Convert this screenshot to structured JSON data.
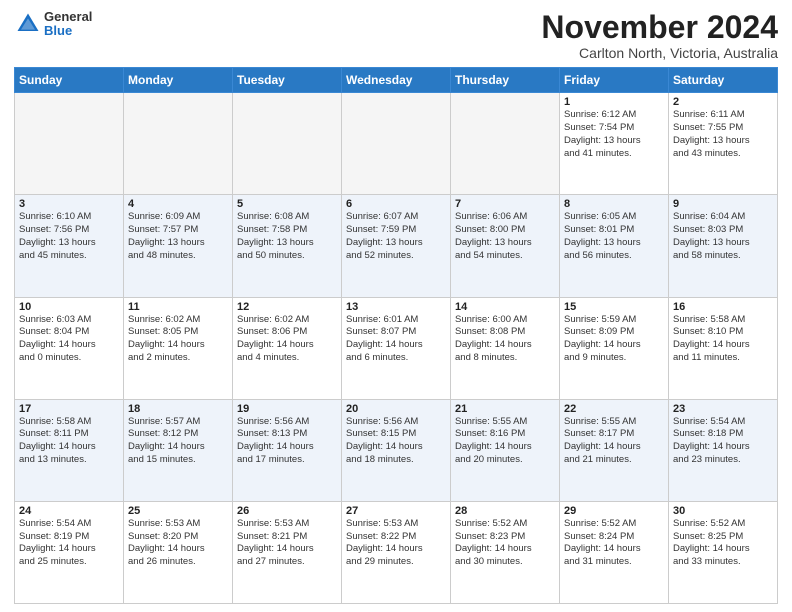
{
  "logo": {
    "general": "General",
    "blue": "Blue"
  },
  "header": {
    "month": "November 2024",
    "location": "Carlton North, Victoria, Australia"
  },
  "weekdays": [
    "Sunday",
    "Monday",
    "Tuesday",
    "Wednesday",
    "Thursday",
    "Friday",
    "Saturday"
  ],
  "weeks": [
    [
      {
        "day": "",
        "info": ""
      },
      {
        "day": "",
        "info": ""
      },
      {
        "day": "",
        "info": ""
      },
      {
        "day": "",
        "info": ""
      },
      {
        "day": "",
        "info": ""
      },
      {
        "day": "1",
        "info": "Sunrise: 6:12 AM\nSunset: 7:54 PM\nDaylight: 13 hours\nand 41 minutes."
      },
      {
        "day": "2",
        "info": "Sunrise: 6:11 AM\nSunset: 7:55 PM\nDaylight: 13 hours\nand 43 minutes."
      }
    ],
    [
      {
        "day": "3",
        "info": "Sunrise: 6:10 AM\nSunset: 7:56 PM\nDaylight: 13 hours\nand 45 minutes."
      },
      {
        "day": "4",
        "info": "Sunrise: 6:09 AM\nSunset: 7:57 PM\nDaylight: 13 hours\nand 48 minutes."
      },
      {
        "day": "5",
        "info": "Sunrise: 6:08 AM\nSunset: 7:58 PM\nDaylight: 13 hours\nand 50 minutes."
      },
      {
        "day": "6",
        "info": "Sunrise: 6:07 AM\nSunset: 7:59 PM\nDaylight: 13 hours\nand 52 minutes."
      },
      {
        "day": "7",
        "info": "Sunrise: 6:06 AM\nSunset: 8:00 PM\nDaylight: 13 hours\nand 54 minutes."
      },
      {
        "day": "8",
        "info": "Sunrise: 6:05 AM\nSunset: 8:01 PM\nDaylight: 13 hours\nand 56 minutes."
      },
      {
        "day": "9",
        "info": "Sunrise: 6:04 AM\nSunset: 8:03 PM\nDaylight: 13 hours\nand 58 minutes."
      }
    ],
    [
      {
        "day": "10",
        "info": "Sunrise: 6:03 AM\nSunset: 8:04 PM\nDaylight: 14 hours\nand 0 minutes."
      },
      {
        "day": "11",
        "info": "Sunrise: 6:02 AM\nSunset: 8:05 PM\nDaylight: 14 hours\nand 2 minutes."
      },
      {
        "day": "12",
        "info": "Sunrise: 6:02 AM\nSunset: 8:06 PM\nDaylight: 14 hours\nand 4 minutes."
      },
      {
        "day": "13",
        "info": "Sunrise: 6:01 AM\nSunset: 8:07 PM\nDaylight: 14 hours\nand 6 minutes."
      },
      {
        "day": "14",
        "info": "Sunrise: 6:00 AM\nSunset: 8:08 PM\nDaylight: 14 hours\nand 8 minutes."
      },
      {
        "day": "15",
        "info": "Sunrise: 5:59 AM\nSunset: 8:09 PM\nDaylight: 14 hours\nand 9 minutes."
      },
      {
        "day": "16",
        "info": "Sunrise: 5:58 AM\nSunset: 8:10 PM\nDaylight: 14 hours\nand 11 minutes."
      }
    ],
    [
      {
        "day": "17",
        "info": "Sunrise: 5:58 AM\nSunset: 8:11 PM\nDaylight: 14 hours\nand 13 minutes."
      },
      {
        "day": "18",
        "info": "Sunrise: 5:57 AM\nSunset: 8:12 PM\nDaylight: 14 hours\nand 15 minutes."
      },
      {
        "day": "19",
        "info": "Sunrise: 5:56 AM\nSunset: 8:13 PM\nDaylight: 14 hours\nand 17 minutes."
      },
      {
        "day": "20",
        "info": "Sunrise: 5:56 AM\nSunset: 8:15 PM\nDaylight: 14 hours\nand 18 minutes."
      },
      {
        "day": "21",
        "info": "Sunrise: 5:55 AM\nSunset: 8:16 PM\nDaylight: 14 hours\nand 20 minutes."
      },
      {
        "day": "22",
        "info": "Sunrise: 5:55 AM\nSunset: 8:17 PM\nDaylight: 14 hours\nand 21 minutes."
      },
      {
        "day": "23",
        "info": "Sunrise: 5:54 AM\nSunset: 8:18 PM\nDaylight: 14 hours\nand 23 minutes."
      }
    ],
    [
      {
        "day": "24",
        "info": "Sunrise: 5:54 AM\nSunset: 8:19 PM\nDaylight: 14 hours\nand 25 minutes."
      },
      {
        "day": "25",
        "info": "Sunrise: 5:53 AM\nSunset: 8:20 PM\nDaylight: 14 hours\nand 26 minutes."
      },
      {
        "day": "26",
        "info": "Sunrise: 5:53 AM\nSunset: 8:21 PM\nDaylight: 14 hours\nand 27 minutes."
      },
      {
        "day": "27",
        "info": "Sunrise: 5:53 AM\nSunset: 8:22 PM\nDaylight: 14 hours\nand 29 minutes."
      },
      {
        "day": "28",
        "info": "Sunrise: 5:52 AM\nSunset: 8:23 PM\nDaylight: 14 hours\nand 30 minutes."
      },
      {
        "day": "29",
        "info": "Sunrise: 5:52 AM\nSunset: 8:24 PM\nDaylight: 14 hours\nand 31 minutes."
      },
      {
        "day": "30",
        "info": "Sunrise: 5:52 AM\nSunset: 8:25 PM\nDaylight: 14 hours\nand 33 minutes."
      }
    ]
  ]
}
